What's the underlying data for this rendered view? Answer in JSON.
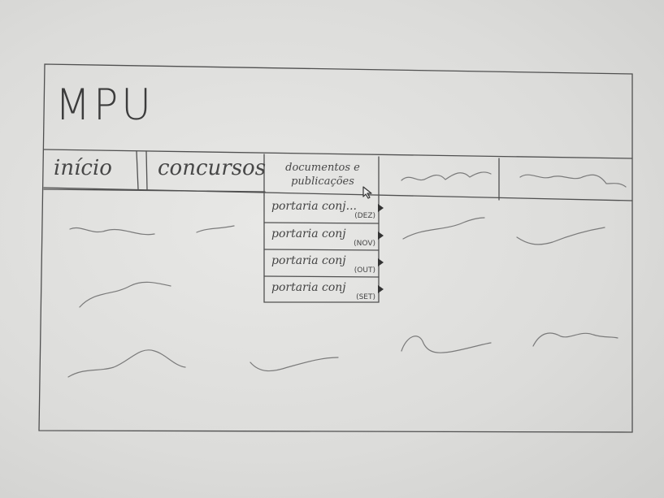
{
  "header": {
    "logo": "MPU"
  },
  "nav": {
    "items": [
      {
        "label": "início"
      },
      {
        "label": "concursos"
      },
      {
        "label": "documentos e publicações"
      },
      {
        "label": ""
      },
      {
        "label": ""
      }
    ]
  },
  "dropdown": {
    "items": [
      {
        "label": "portaria conj...",
        "sub": "(DEZ)"
      },
      {
        "label": "portaria conj",
        "sub": "(NOV)"
      },
      {
        "label": "portaria conj",
        "sub": "(OUT)"
      },
      {
        "label": "portaria conj",
        "sub": "(SET)"
      }
    ]
  },
  "icons": {
    "pointer": "mouse-pointer-icon",
    "submenu": "triangle-right-icon"
  },
  "colors": {
    "ink": "#444444",
    "paper": "#e2e2e0"
  }
}
